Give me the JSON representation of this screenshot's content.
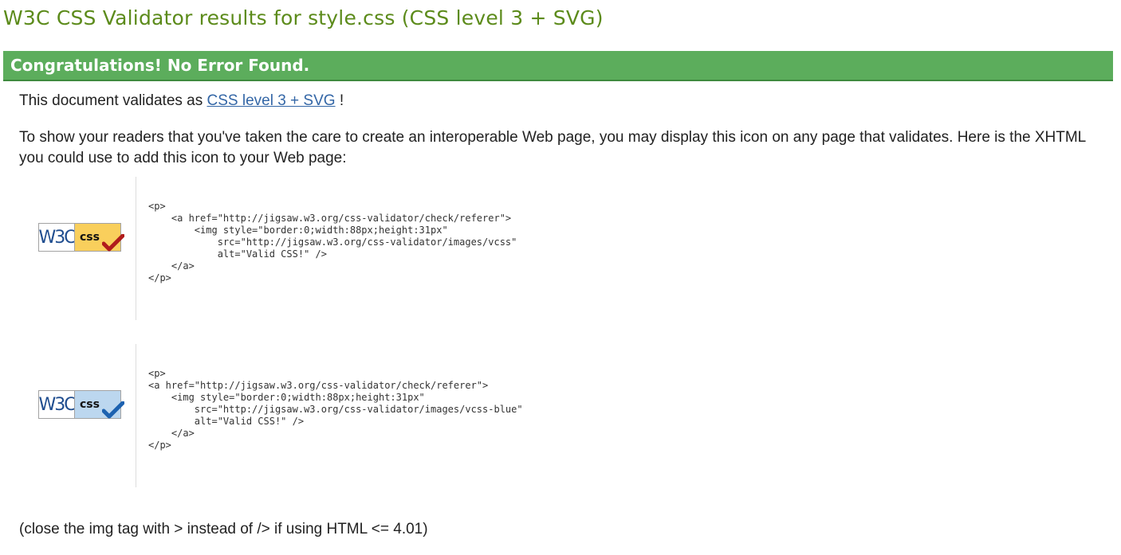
{
  "page": {
    "title": "W3C CSS Validator results for style.css (CSS level 3 + SVG)",
    "banner": "Congratulations! No Error Found."
  },
  "validation": {
    "prefix": "This document validates as ",
    "profile_link": "CSS level 3 + SVG",
    "suffix": " !"
  },
  "intro": "To show your readers that you've taken the care to create an interoperable Web page, you may display this icon on any page that validates. Here is the XHTML you could use to add this icon to your Web page:",
  "badges": [
    {
      "icon": "valid-css-gold-badge",
      "w3c_text": "W3C",
      "css_text": "css",
      "accent": "#f9cf5c",
      "check_color": "#b01c1c",
      "code": "<p>\n    <a href=\"http://jigsaw.w3.org/css-validator/check/referer\">\n        <img style=\"border:0;width:88px;height:31px\"\n            src=\"http://jigsaw.w3.org/css-validator/images/vcss\"\n            alt=\"Valid CSS!\" />\n    </a>\n</p>"
    },
    {
      "icon": "valid-css-blue-badge",
      "w3c_text": "W3C",
      "css_text": "css",
      "accent": "#bcd7ef",
      "check_color": "#1d62b0",
      "code": "<p>\n<a href=\"http://jigsaw.w3.org/css-validator/check/referer\">\n    <img style=\"border:0;width:88px;height:31px\"\n        src=\"http://jigsaw.w3.org/css-validator/images/vcss-blue\"\n        alt=\"Valid CSS!\" />\n    </a>\n</p>"
    }
  ],
  "note": "(close the img tag with > instead of /> if using HTML <= 4.01)",
  "colors": {
    "title": "#5c8b1b",
    "banner_bg": "#5cad5c",
    "link": "#3366a6"
  }
}
